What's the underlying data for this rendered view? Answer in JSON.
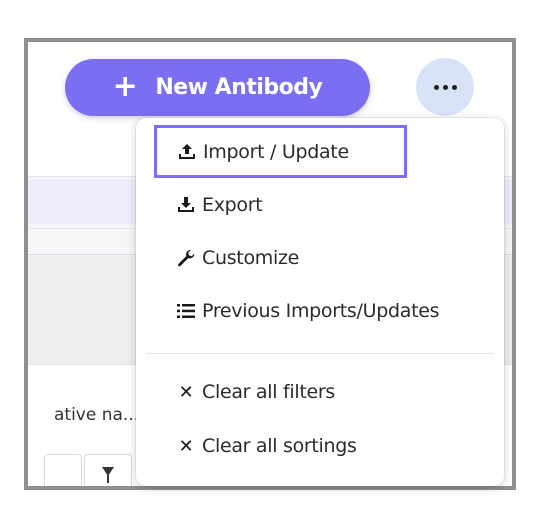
{
  "toolbar": {
    "new_button_label": "New Antibody",
    "new_button_icon": "plus-icon",
    "more_button_icon": "more-icon"
  },
  "table": {
    "partial_column_label": "ative na..."
  },
  "menu": {
    "items": [
      {
        "label": "Import / Update",
        "icon": "upload-icon"
      },
      {
        "label": "Export",
        "icon": "download-icon"
      },
      {
        "label": "Customize",
        "icon": "wrench-icon"
      },
      {
        "label": "Previous Imports/Updates",
        "icon": "list-icon"
      },
      {
        "label": "Clear all filters",
        "icon": "close-icon"
      },
      {
        "label": "Clear all sortings",
        "icon": "close-icon"
      }
    ]
  },
  "colors": {
    "accent": "#7b6ef0",
    "more_button_bg": "#d9e3f7",
    "frame_border": "#8f8f8f"
  }
}
